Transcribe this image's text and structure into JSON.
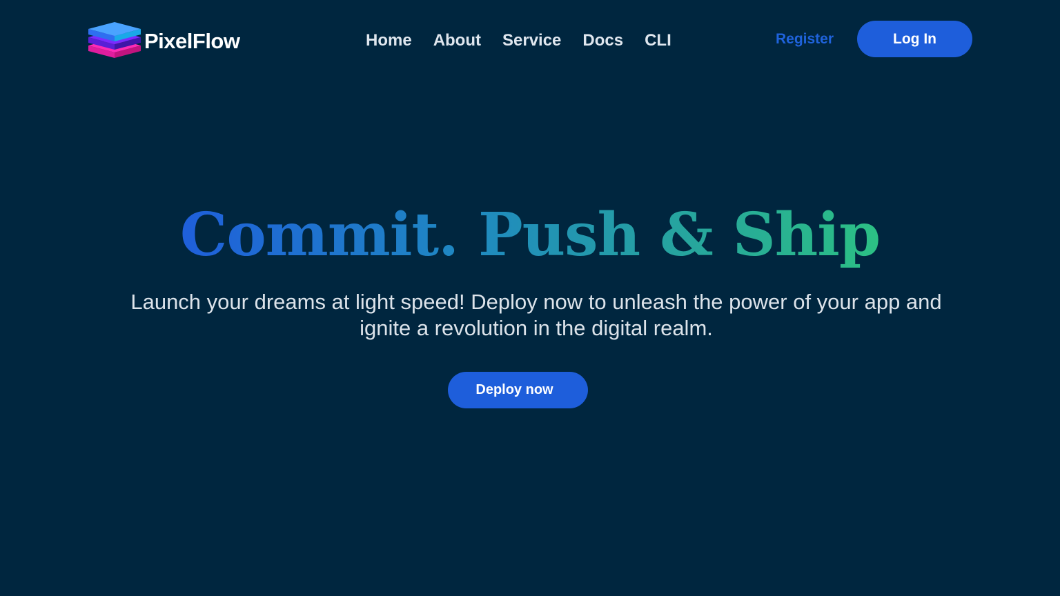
{
  "header": {
    "brand": "PixelFlow",
    "nav": [
      {
        "label": "Home"
      },
      {
        "label": "About"
      },
      {
        "label": "Service"
      },
      {
        "label": "Docs"
      },
      {
        "label": "CLI"
      }
    ],
    "register_label": "Register",
    "login_label": "Log In"
  },
  "hero": {
    "title": "Commit. Push & Ship",
    "subtitle": "Launch your dreams at light speed! Deploy now to unleash the power of your app and ignite a revolution in the digital realm.",
    "cta_label": "Deploy now"
  },
  "colors": {
    "background": "#00263f",
    "accent": "#1e5edb",
    "gradient_start": "#1f5fdb",
    "gradient_end": "#2cc084"
  },
  "icons": {
    "logo": "stacked-layers-icon"
  }
}
